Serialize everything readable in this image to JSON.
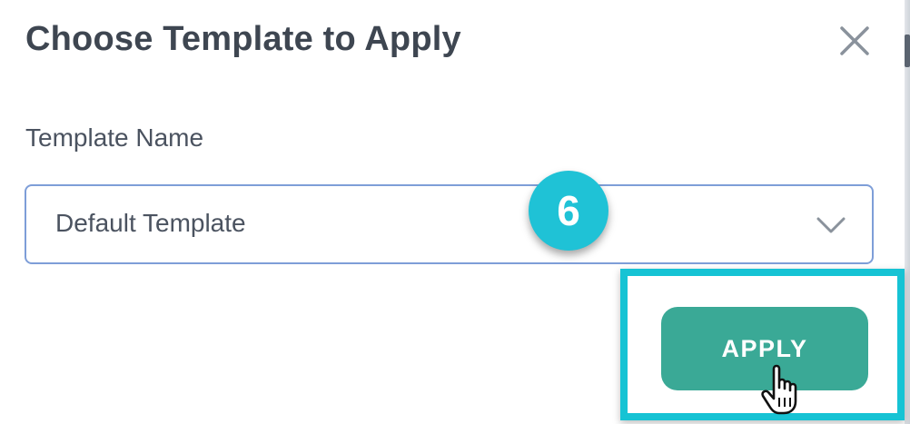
{
  "dialog": {
    "title": "Choose Template to Apply",
    "close_icon": "close-icon"
  },
  "form": {
    "template_label": "Template Name",
    "template_select": {
      "selected": "Default Template",
      "icon": "chevron-down-icon"
    }
  },
  "tutorial": {
    "step_number": "6",
    "highlight_color": "#16c3d4",
    "badge_color": "#1fc2d6"
  },
  "actions": {
    "apply_label": "APPLY",
    "apply_color": "#3aa996"
  },
  "cursor": {
    "icon": "hand-pointer-icon"
  }
}
